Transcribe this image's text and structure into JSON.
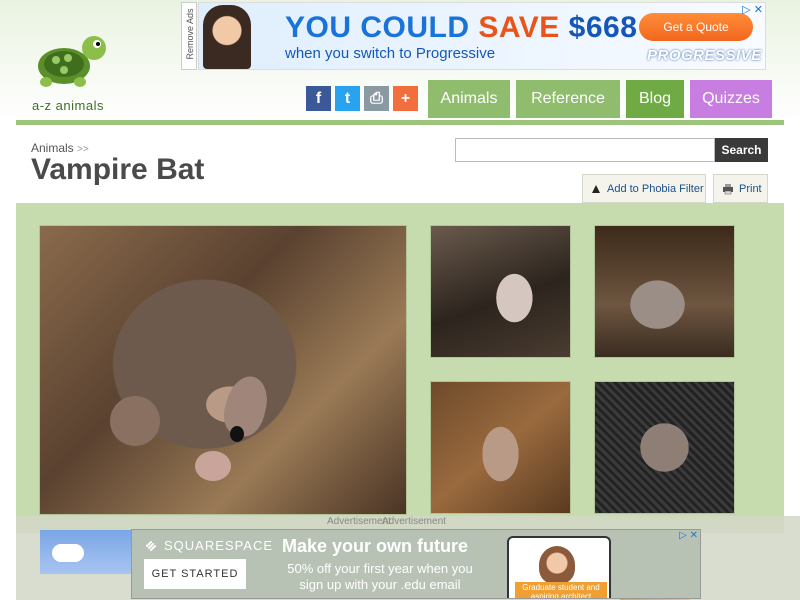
{
  "header": {
    "logo_text": "a-z animals",
    "remove_ads": "Remove Ads",
    "social": {
      "facebook": "f",
      "twitter": "t",
      "print": "⎙",
      "plus": "+"
    },
    "nav": [
      "Animals",
      "Reference",
      "Blog",
      "Quizzes"
    ]
  },
  "top_ad": {
    "line1_a": "YOU COULD ",
    "line1_save": "SAVE ",
    "line1_amount": "$668",
    "line2": "when you switch to Progressive",
    "cta": "Get a Quote",
    "brand": "PROGRESSIVE",
    "ad_info": "▷ ✕"
  },
  "page": {
    "breadcrumb": "Animals",
    "breadcrumb_sep": ">>",
    "title": "Vampire Bat",
    "search_placeholder": "",
    "search_button": "Search",
    "phobia_button": "Add to Phobia Filter",
    "print_button": "Print"
  },
  "bottom_ad": {
    "label": "Advertisement",
    "logo": "SQUARESPACE",
    "cta": "GET STARTED",
    "headline": "Make your own future",
    "sub": "50% off your first year when you sign up with your .edu email",
    "phone_caption": "Graduate student and aspiring architect",
    "ad_info": "▷ ✕"
  },
  "colors": {
    "nav_green": "#8fbd6d",
    "nav_dark_green": "#6faa45",
    "nav_purple": "#c77ee0",
    "gallery_bg": "#c7dcae"
  }
}
